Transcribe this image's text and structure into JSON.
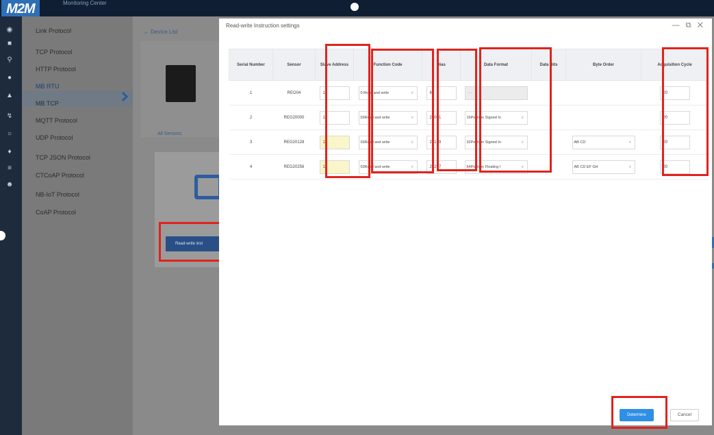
{
  "app": {
    "logo": "M2M",
    "subtitle": "Monitoring Center"
  },
  "sidebar": {
    "items": [
      {
        "label": "Link Protocol"
      },
      {
        "label": "TCP Protocol"
      },
      {
        "label": "HTTP Protocol"
      },
      {
        "label": "MB RTU"
      },
      {
        "label": "MB TCP"
      },
      {
        "label": "MQTT Protocol"
      },
      {
        "label": "UDP Protocol"
      },
      {
        "label": "TCP JSON Protocol"
      },
      {
        "label": "CTCoAP Protocol"
      },
      {
        "label": "NB-IoT Protocol"
      },
      {
        "label": "CoAP Protocol"
      }
    ],
    "active_index": 3
  },
  "background": {
    "back_link": "← Device List",
    "all_sensors_tab": "All Sensors",
    "read_write_button": "Read-write inst"
  },
  "modal": {
    "title": "Read-write Instruction settings",
    "controls": "— ⧉ ✕",
    "columns": [
      "Serial Number",
      "Sensor",
      "Slave Address",
      "Function Code",
      "Bias",
      "Data Format",
      "Data Bits",
      "Byte Order",
      "Acquisition Cycle"
    ],
    "rows": [
      {
        "serial": "1",
        "sensor": "REG04",
        "slave": "1",
        "function": "0:Read and write",
        "bias": "65",
        "format": "---",
        "data_bits": "",
        "byte_order": "",
        "cycle": "20"
      },
      {
        "serial": "2",
        "sensor": "REG20000",
        "slave": "1",
        "function": "03Read and write",
        "bias": "20001",
        "format": "16Position Signed In",
        "data_bits": "",
        "byte_order": "",
        "cycle": "20"
      },
      {
        "serial": "3",
        "sensor": "REG20128",
        "slave": "1",
        "function": "03Read and write",
        "bias": "20129",
        "format": "32Position Signed In",
        "data_bits": "",
        "byte_order": "AB CD",
        "cycle": "20"
      },
      {
        "serial": "4",
        "sensor": "REG20256",
        "slave": "1",
        "function": "03Read and write",
        "bias": "20257",
        "format": "64Position Floating I",
        "data_bits": "",
        "byte_order": "AB CD EF GH",
        "cycle": "20"
      }
    ],
    "confirm_label": "Determine",
    "cancel_label": "Cancel"
  },
  "colors": {
    "highlight": "#e0231c",
    "primary": "#2f8fe6"
  }
}
